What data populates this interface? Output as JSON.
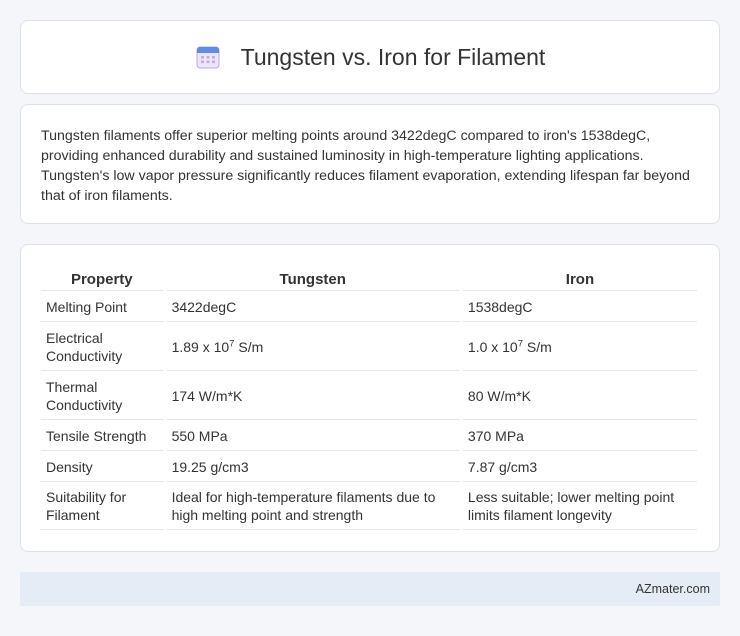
{
  "header": {
    "title": "Tungsten vs. Iron for Filament",
    "icon": "calendar-icon"
  },
  "intro": {
    "text": "Tungsten filaments offer superior melting points around 3422degC compared to iron's 1538degC, providing enhanced durability and sustained luminosity in high-temperature lighting applications. Tungsten's low vapor pressure significantly reduces filament evaporation, extending lifespan far beyond that of iron filaments."
  },
  "table": {
    "headers": [
      "Property",
      "Tungsten",
      "Iron"
    ],
    "rows": [
      {
        "property": "Melting Point",
        "tungsten": "3422degC",
        "iron": "1538degC"
      },
      {
        "property": "Electrical Conductivity",
        "tungsten_base": "1.89 x 10",
        "tungsten_exp": "7",
        "tungsten_unit": " S/m",
        "iron_base": "1.0 x 10",
        "iron_exp": "7",
        "iron_unit": " S/m"
      },
      {
        "property": "Thermal Conductivity",
        "tungsten": "174 W/m*K",
        "iron": "80 W/m*K"
      },
      {
        "property": "Tensile Strength",
        "tungsten": "550 MPa",
        "iron": "370 MPa"
      },
      {
        "property": "Density",
        "tungsten": "19.25 g/cm3",
        "iron": "7.87 g/cm3"
      },
      {
        "property": "Suitability for Filament",
        "tungsten": "Ideal for high-temperature filaments due to high melting point and strength",
        "iron": "Less suitable; lower melting point limits filament longevity"
      }
    ]
  },
  "footer": {
    "text": "AZmater.com"
  }
}
